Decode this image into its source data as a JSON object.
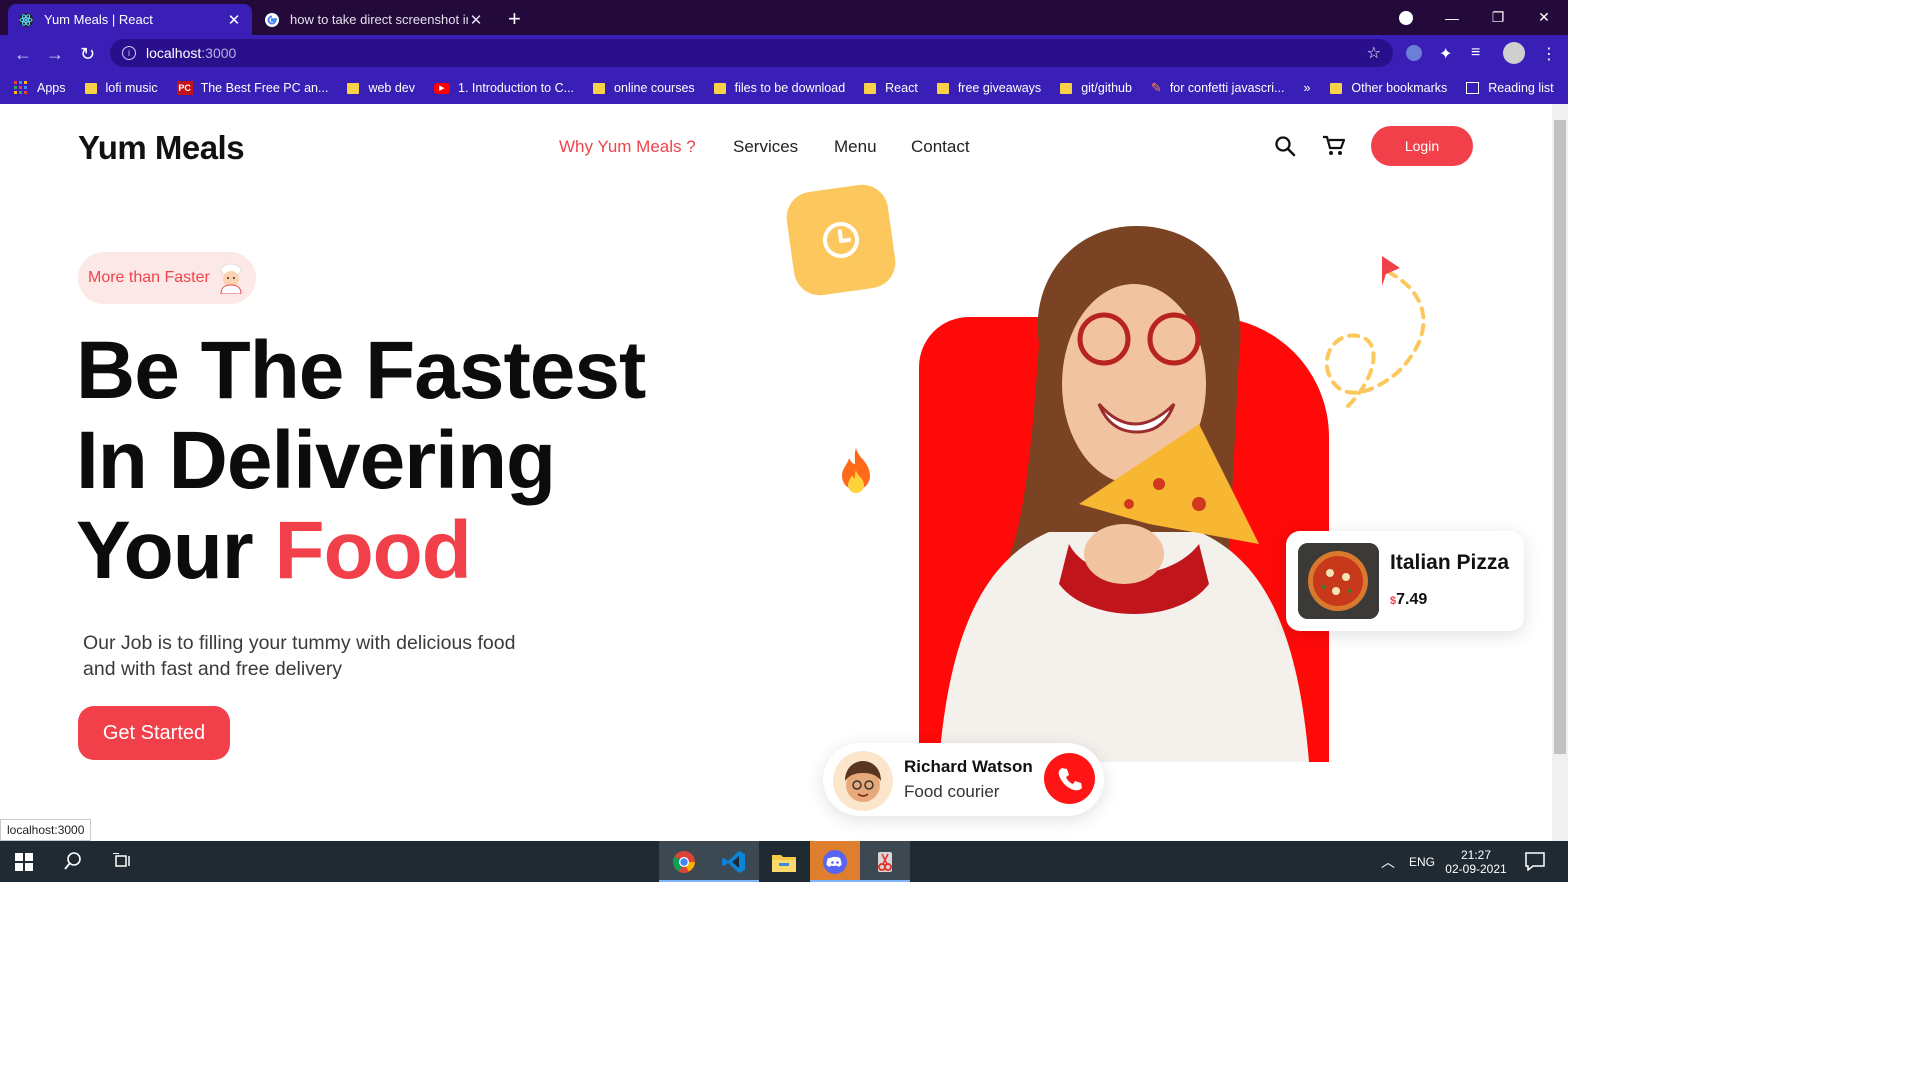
{
  "browser": {
    "tabs": [
      {
        "title": "Yum Meals | React",
        "active": true
      },
      {
        "title": "how to take direct screenshot in",
        "active": false
      }
    ],
    "new_tab": "+",
    "url": {
      "host": "localhost",
      "port": ":3000"
    },
    "bookmarks": [
      {
        "label": "Apps",
        "icon": "apps-grid-icon"
      },
      {
        "label": "lofi music",
        "icon": "folder-icon"
      },
      {
        "label": "The Best Free PC an...",
        "icon": "pc-site-icon"
      },
      {
        "label": "web dev",
        "icon": "folder-icon"
      },
      {
        "label": "1. Introduction to C...",
        "icon": "youtube-icon"
      },
      {
        "label": "online courses",
        "icon": "folder-icon"
      },
      {
        "label": "files to be download",
        "icon": "folder-icon"
      },
      {
        "label": "React",
        "icon": "folder-icon"
      },
      {
        "label": "free giveaways",
        "icon": "folder-icon"
      },
      {
        "label": "git/github",
        "icon": "folder-icon"
      },
      {
        "label": "for confetti javascri...",
        "icon": "site-icon"
      }
    ],
    "bookmarks_overflow": "»",
    "other_bookmarks": "Other bookmarks",
    "reading_list": "Reading list",
    "status_url": "localhost:3000"
  },
  "site": {
    "logo": "Yum Meals",
    "nav": [
      "Why Yum Meals ?",
      "Services",
      "Menu",
      "Contact"
    ],
    "login": "Login",
    "badge": "More than Faster",
    "headline": {
      "line1": "Be The Fastest",
      "line2": "In Delivering",
      "line3_prefix": "Your ",
      "line3_accent": "Food"
    },
    "subtitle": "Our Job is to filling your tummy with delicious food and with fast and free delivery",
    "cta": "Get Started",
    "pizza_card": {
      "name": "Italian Pizza",
      "currency": "$",
      "price": "7.49"
    },
    "courier": {
      "name": "Richard Watson",
      "role": "Food courier"
    },
    "colors": {
      "accent": "#f2404a",
      "yellow": "#fcc75d",
      "photo_bg": "#ff0909"
    }
  },
  "taskbar": {
    "lang": "ENG",
    "time": "21:27",
    "date": "02-09-2021"
  }
}
